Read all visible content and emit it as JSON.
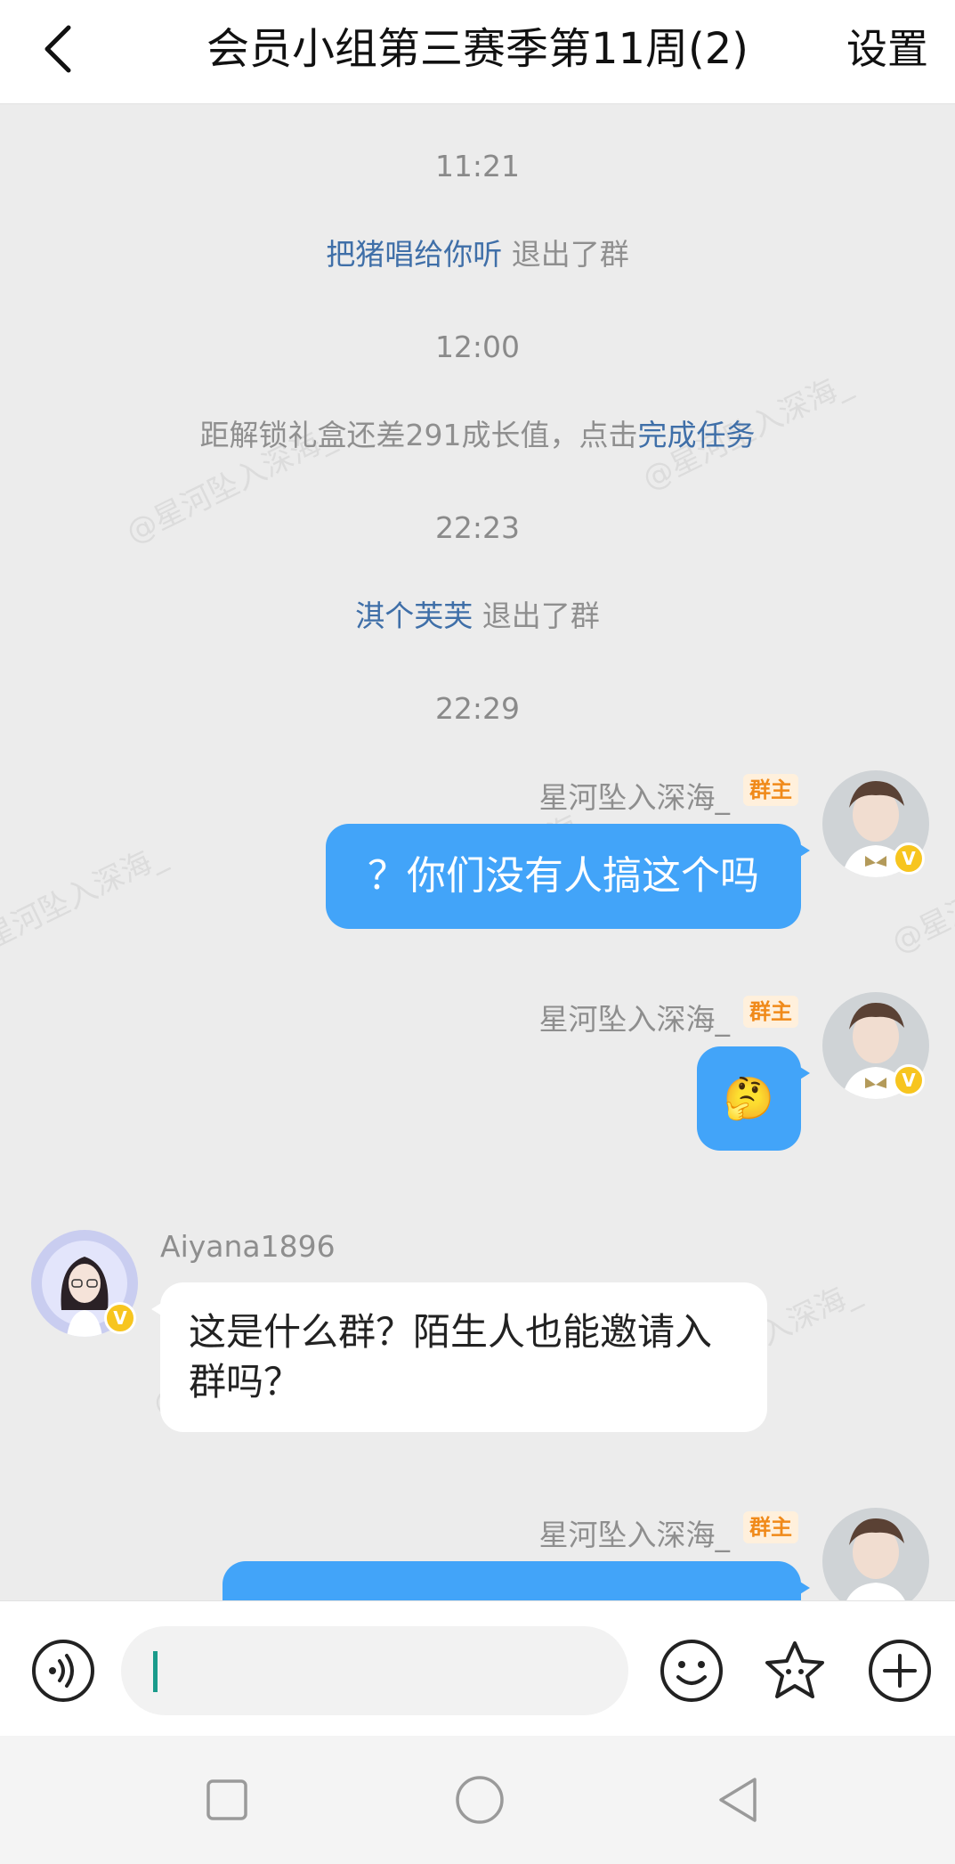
{
  "header": {
    "title": "会员小组第三赛季第11周(2)",
    "settings_label": "设置"
  },
  "watermark_text": "@星河坠入深海_",
  "messages": {
    "t1": "11:21",
    "event1": {
      "user": "把猪唱给你听",
      "action": "退出了群"
    },
    "t2": "12:00",
    "event2": {
      "text": "距解锁礼盒还差291成长值，点击",
      "link": "完成任务"
    },
    "t3": "22:23",
    "event3": {
      "user": "淇个芙芙",
      "action": "退出了群"
    },
    "t4": "22:29",
    "msg1": {
      "sender": "星河坠入深海_",
      "role": "群主",
      "text": "？你们没有人搞这个吗"
    },
    "msg2": {
      "sender": "星河坠入深海_",
      "role": "群主",
      "emoji": "🤔"
    },
    "msg3": {
      "sender": "Aiyana1896",
      "text": "这是什么群？陌生人也能邀请入群吗？"
    },
    "msg4": {
      "sender": "星河坠入深海_",
      "role": "群主"
    }
  },
  "composer": {
    "value": "",
    "placeholder": ""
  },
  "icons": [
    "back-arrow-icon",
    "voice-icon",
    "emoji-icon",
    "favorite-sticker-icon",
    "plus-icon",
    "nav-recents-icon",
    "nav-home-icon",
    "nav-back-icon"
  ],
  "colors": {
    "outgoing_bubble": "#42a4f9",
    "link": "#3f6fa8",
    "badge_text": "#f08a1a",
    "badge_bg": "#fff0dc",
    "vip": "#f7c51f",
    "cursor": "#1a9b8b"
  }
}
